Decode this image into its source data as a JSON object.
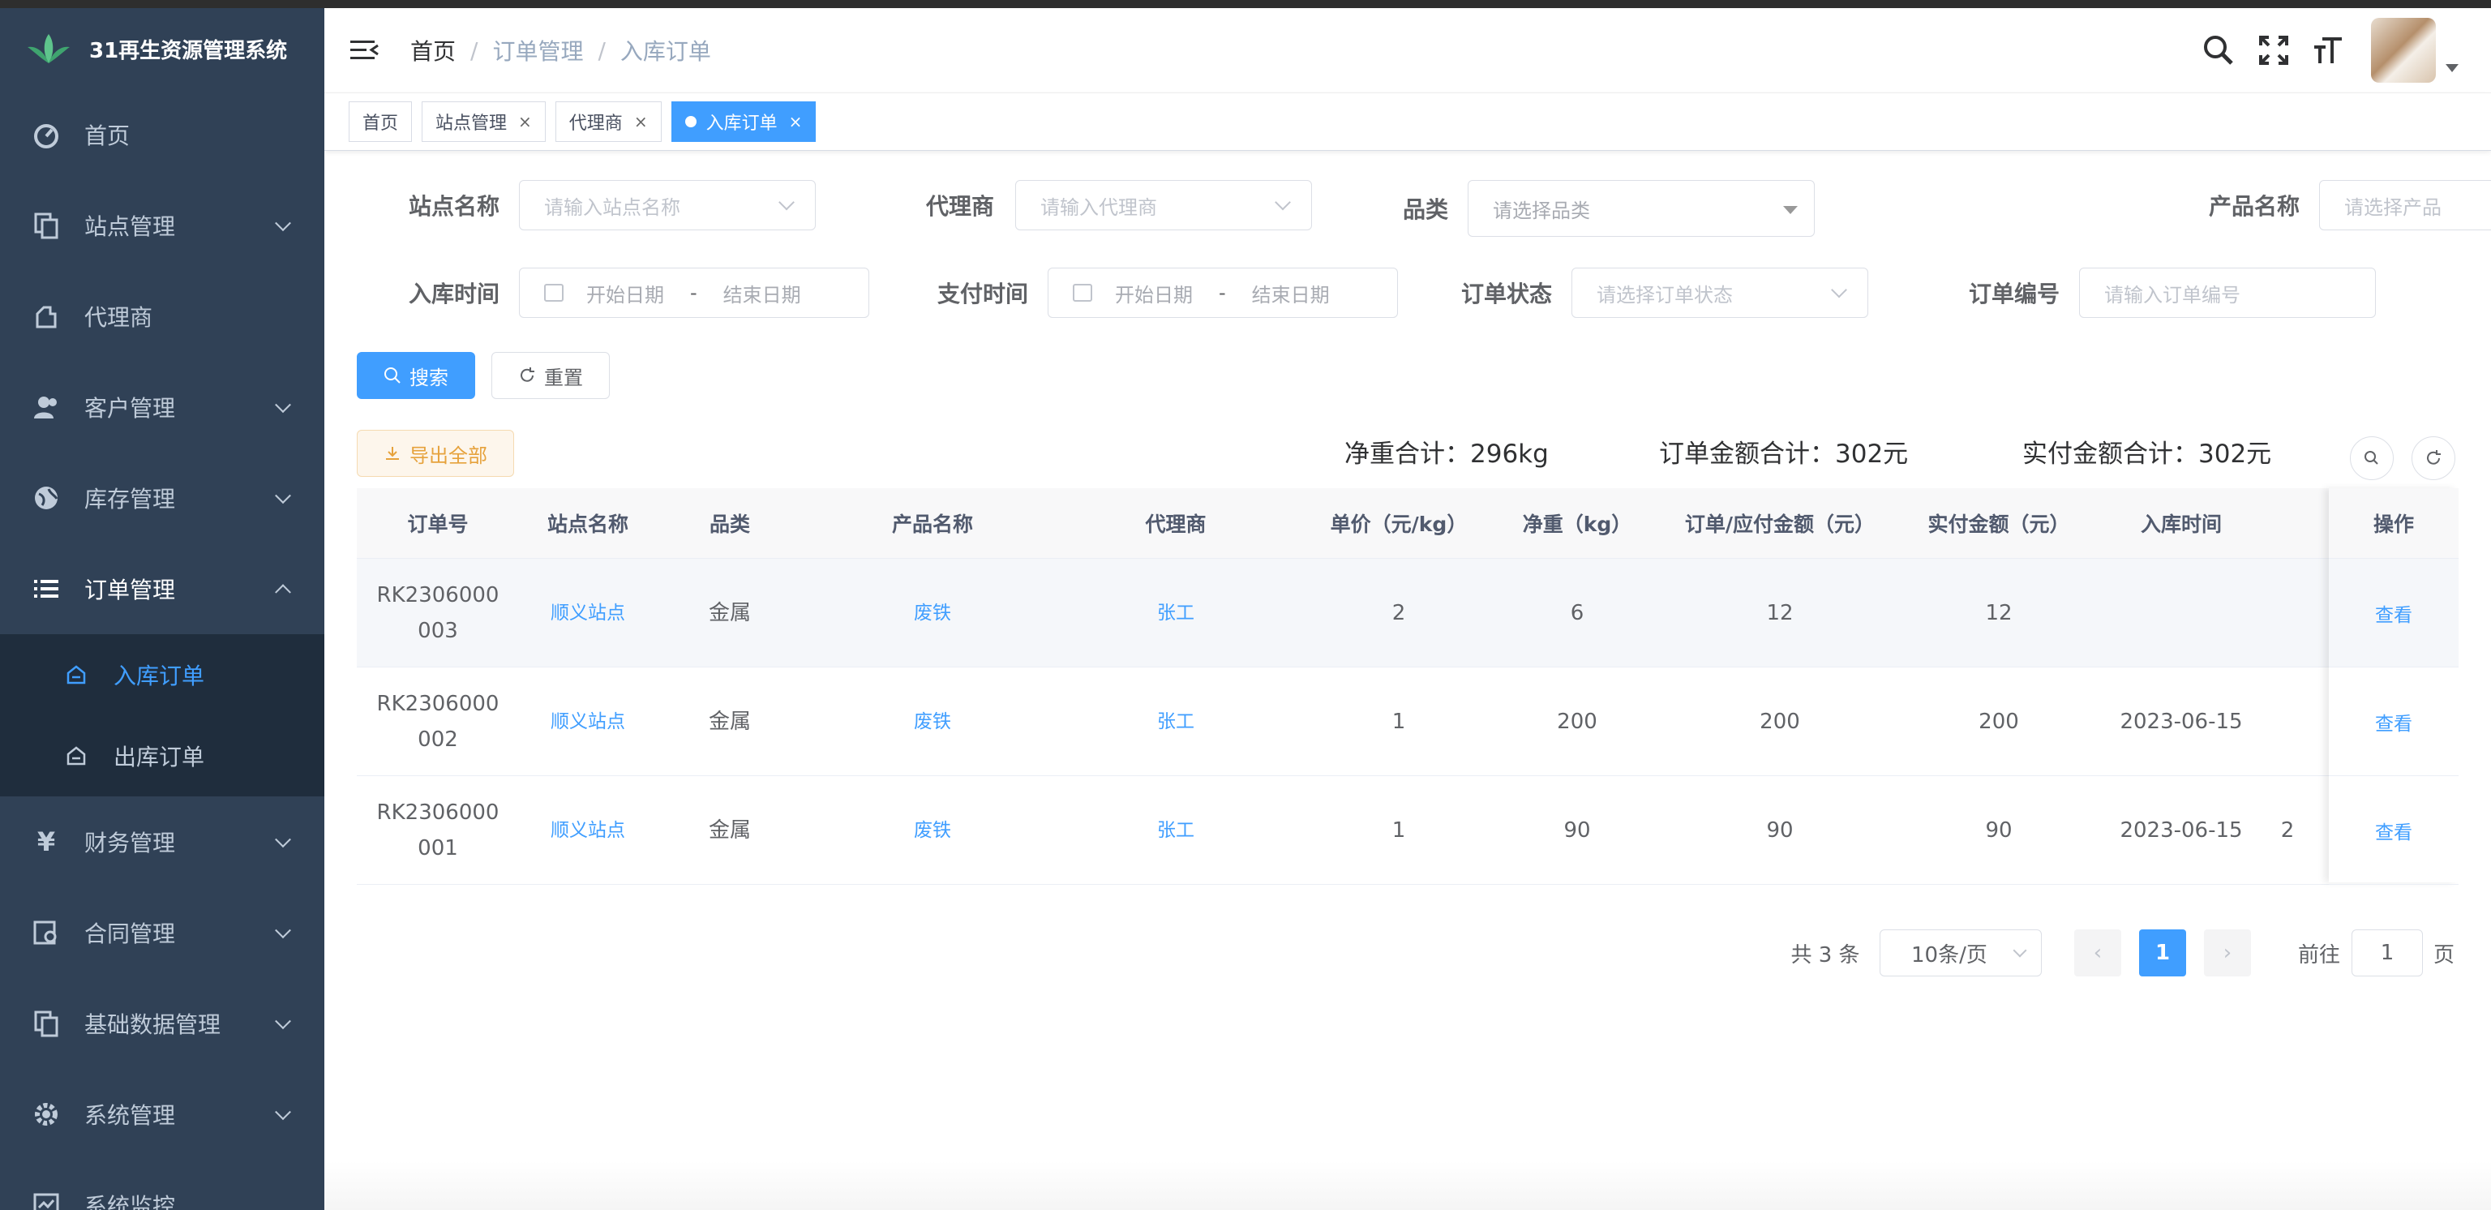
{
  "app": {
    "title": "31再生资源管理系统"
  },
  "sidebar": {
    "items": [
      {
        "label": "首页",
        "icon": "dashboard-icon",
        "expandable": false
      },
      {
        "label": "站点管理",
        "icon": "copy-icon",
        "expandable": true
      },
      {
        "label": "代理商",
        "icon": "agent-icon",
        "expandable": false
      },
      {
        "label": "客户管理",
        "icon": "peoples-icon",
        "expandable": true
      },
      {
        "label": "库存管理",
        "icon": "globe-icon",
        "expandable": true
      },
      {
        "label": "订单管理",
        "icon": "list-icon",
        "expandable": true,
        "open": true
      },
      {
        "label": "财务管理",
        "icon": "yen-icon",
        "expandable": true
      },
      {
        "label": "合同管理",
        "icon": "contract-icon",
        "expandable": true
      },
      {
        "label": "基础数据管理",
        "icon": "copy-icon",
        "expandable": true
      },
      {
        "label": "系统管理",
        "icon": "gear-icon",
        "expandable": true
      },
      {
        "label": "系统监控",
        "icon": "monitor-icon",
        "expandable": true
      }
    ],
    "order_sub": [
      {
        "label": "入库订单",
        "active": true
      },
      {
        "label": "出库订单",
        "active": false
      }
    ]
  },
  "breadcrumb": {
    "home": "首页",
    "parent": "订单管理",
    "current": "入库订单"
  },
  "tags": [
    {
      "label": "首页",
      "closable": false,
      "active": false
    },
    {
      "label": "站点管理",
      "closable": true,
      "active": false
    },
    {
      "label": "代理商",
      "closable": true,
      "active": false
    },
    {
      "label": "入库订单",
      "closable": true,
      "active": true
    }
  ],
  "close_glyph": "×",
  "filters": {
    "station": {
      "label": "站点名称",
      "placeholder": "请输入站点名称"
    },
    "agent": {
      "label": "代理商",
      "placeholder": "请输入代理商"
    },
    "category": {
      "label": "品类",
      "placeholder": "请选择品类"
    },
    "product": {
      "label": "产品名称",
      "placeholder": "请选择产品"
    },
    "in_time": {
      "label": "入库时间",
      "start": "开始日期",
      "end": "结束日期"
    },
    "pay_time": {
      "label": "支付时间",
      "start": "开始日期",
      "end": "结束日期"
    },
    "status": {
      "label": "订单状态",
      "placeholder": "请选择订单状态"
    },
    "order_no": {
      "label": "订单编号",
      "placeholder": "请输入订单编号"
    },
    "range_sep": "-"
  },
  "buttons": {
    "search": "搜索",
    "reset": "重置",
    "export": "导出全部"
  },
  "summary": {
    "net_weight": "净重合计：296kg",
    "order_amount": "订单金额合计：302元",
    "paid_amount": "实付金额合计：302元"
  },
  "table": {
    "headers": [
      "订单号",
      "站点名称",
      "品类",
      "产品名称",
      "代理商",
      "单价（元/kg）",
      "净重（kg）",
      "订单/应付金额（元）",
      "实付金额（元）",
      "入库时间"
    ],
    "op_header": "操作",
    "rows": [
      {
        "order_no_1": "RK2306000",
        "order_no_2": "003",
        "station": "顺义站点",
        "category": "金属",
        "product": "废铁",
        "agent": "张工",
        "price": "2",
        "weight": "6",
        "amount": "12",
        "paid": "12",
        "time": "",
        "extra": "",
        "op": "查看"
      },
      {
        "order_no_1": "RK2306000",
        "order_no_2": "002",
        "station": "顺义站点",
        "category": "金属",
        "product": "废铁",
        "agent": "张工",
        "price": "1",
        "weight": "200",
        "amount": "200",
        "paid": "200",
        "time": "2023-06-15",
        "extra": "",
        "op": "查看"
      },
      {
        "order_no_1": "RK2306000",
        "order_no_2": "001",
        "station": "顺义站点",
        "category": "金属",
        "product": "废铁",
        "agent": "张工",
        "price": "1",
        "weight": "90",
        "amount": "90",
        "paid": "90",
        "time": "2023-06-15",
        "extra": "2",
        "op": "查看"
      }
    ]
  },
  "pagination": {
    "total": "共 3 条",
    "page_size": "10条/页",
    "current": "1",
    "goto_label": "前往",
    "goto_value": "1",
    "page_suffix": "页"
  },
  "colors": {
    "sidebar_bg": "#304156",
    "submenu_bg": "#1f2d3d",
    "accent": "#409eff",
    "warning": "#e6a23c"
  }
}
